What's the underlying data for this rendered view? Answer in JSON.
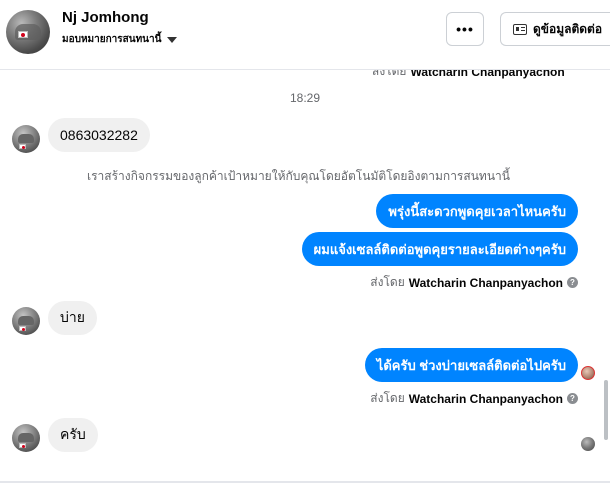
{
  "header": {
    "name": "Nj Jomhong",
    "subtitle": "มอบหมายการสนทนานี้",
    "more_label": "•••",
    "contact_label": "ดูข้อมูลติดต่อ"
  },
  "icons": {
    "more": "more-options-icon",
    "contact": "contact-card-icon",
    "dropdown": "chevron-down-icon",
    "help": "question-circle-icon"
  },
  "colors": {
    "outgoing_bubble": "#0084ff",
    "incoming_bubble": "#f0f0f0",
    "meta_text": "#65676b"
  },
  "chat": {
    "sent_by_prefix": "ส่งโดย",
    "sender": "Watcharin Chanpanyachon",
    "help_glyph": "?",
    "timestamp": "18:29",
    "messages": {
      "phone": "0863032282",
      "system_note": "เราสร้างกิจกรรมของลูกค้าเป้าหมายให้กับคุณโดยอัตโนมัติโดยอิงตามการสนทนานี้",
      "out_1": "พรุ่งนี้สะดวกพูดคุยเวลาไหนครับ",
      "out_2": "ผมแจ้งเซลล์ติดต่อพูดคุยรายละเอียดต่างๆครับ",
      "in_afternoon": "บ่าย",
      "out_3": "ได้ครับ ช่วงบ่ายเซลล์ติดต่อไปครับ",
      "in_ok": "ครับ"
    }
  }
}
